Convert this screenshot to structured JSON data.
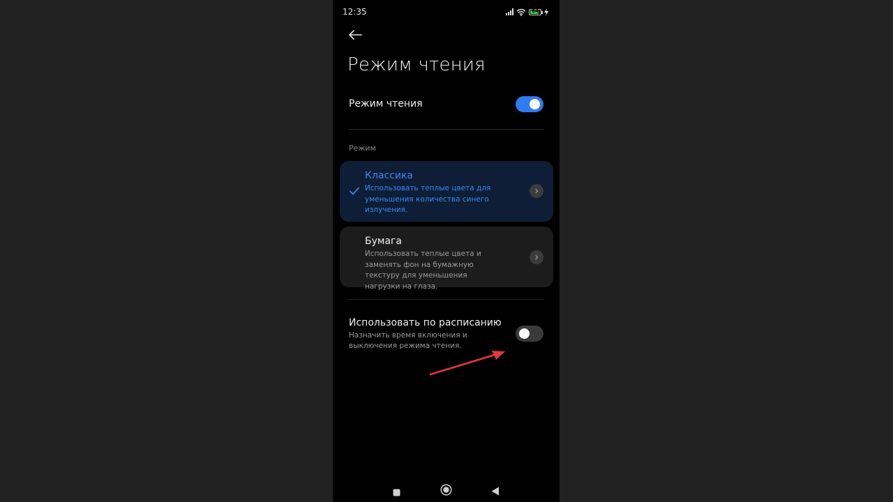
{
  "status_bar": {
    "time": "12:35",
    "battery_level": "84"
  },
  "header": {
    "title": "Режим чтения"
  },
  "reading_mode": {
    "label": "Режим чтения",
    "enabled": true
  },
  "mode_section": {
    "label": "Режим",
    "options": [
      {
        "title": "Классика",
        "description": "Использовать теплые цвета для уменьшения количества синего излучения.",
        "selected": true
      },
      {
        "title": "Бумага",
        "description": "Использовать теплые цвета и заменять фон на бумажную текстуру для уменьшения нагрузки на глаза.",
        "selected": false
      }
    ]
  },
  "schedule": {
    "title": "Использовать по расписанию",
    "description": "Назначить время включения и выключения режима чтения.",
    "enabled": false
  },
  "colors": {
    "accent": "#2f7bf0",
    "selected_card": "#0d1e36",
    "annotation_arrow": "#e0393e"
  }
}
